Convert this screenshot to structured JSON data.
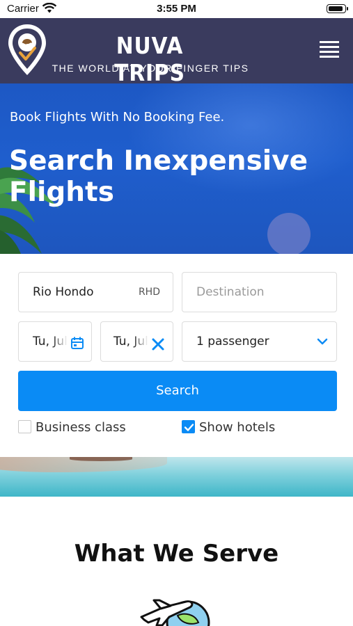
{
  "status_bar": {
    "carrier": "Carrier",
    "time": "3:55 PM",
    "icons": [
      "wifi-icon",
      "battery-icon"
    ]
  },
  "header": {
    "brand": "NUVA TRIPS",
    "tagline": "THE WORLD AT YOUR FINGER TIPS",
    "logo_icon": "map-pin-logo-icon",
    "menu_icon": "hamburger-menu-icon",
    "background_color": "#3a3b5e",
    "logo_accent_color": "#e8a23a"
  },
  "hero": {
    "subtitle": "Book Flights With No Booking Fee.",
    "title": "Search Inexpensive Flights",
    "background_color": "#1d58c4"
  },
  "search_form": {
    "origin": {
      "value": "Rio Hondo",
      "code": "RHD"
    },
    "destination": {
      "placeholder": "Destination",
      "value": ""
    },
    "depart_date": {
      "value": "Tu, Jul",
      "icon": "calendar-icon"
    },
    "return_date": {
      "value": "Tu, Jul",
      "icon": "clear-x-icon"
    },
    "passengers": {
      "value": "1 passenger",
      "icon": "chevron-down-icon"
    },
    "search_button": "Search",
    "business_class": {
      "label": "Business class",
      "checked": false
    },
    "show_hotels": {
      "label": "Show hotels",
      "checked": true
    },
    "accent_color": "#0a8bf5"
  },
  "services": {
    "title": "What We Serve",
    "icon": "airplane-globe-icon"
  }
}
